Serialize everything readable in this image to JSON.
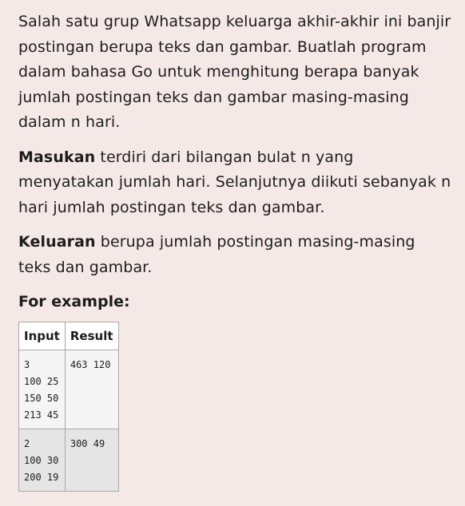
{
  "paragraphs": {
    "p1_text": "Salah satu grup Whatsapp keluarga akhir-akhir ini banjir postingan berupa teks dan gambar. Buatlah program dalam bahasa Go untuk menghitung berapa banyak jumlah postingan teks dan gambar masing-masing dalam n hari.",
    "p2_bold": "Masukan",
    "p2_text": " terdiri dari bilangan bulat n yang menyatakan jumlah hari. Selanjutnya diikuti sebanyak n hari jumlah postingan teks dan gambar.",
    "p3_bold": "Keluaran",
    "p3_text": " berupa jumlah postingan masing-masing teks dan gambar."
  },
  "example": {
    "heading": "For example:",
    "columns": [
      "Input",
      "Result"
    ],
    "rows": [
      {
        "input": "3\n100 25\n150 50\n213 45",
        "result": "463 120"
      },
      {
        "input": "2\n100 30\n200 19",
        "result": "300 49"
      }
    ]
  }
}
